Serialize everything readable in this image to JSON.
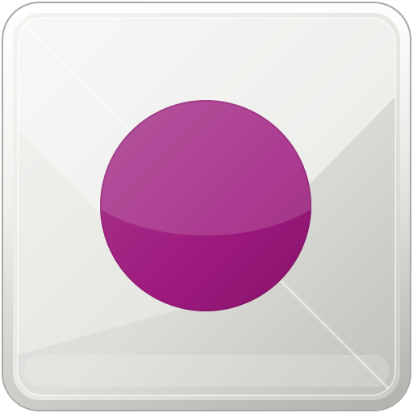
{
  "icon": {
    "name": "record-icon",
    "colors": {
      "tile_light": "#f4f4f2",
      "tile_mid": "#e6e6e2",
      "tile_dark": "#c9c9c4",
      "tile_edge": "#a9a9a4",
      "dot_light": "#a83a8c",
      "dot_main": "#9e1a7e",
      "dot_dark": "#86126a"
    }
  }
}
